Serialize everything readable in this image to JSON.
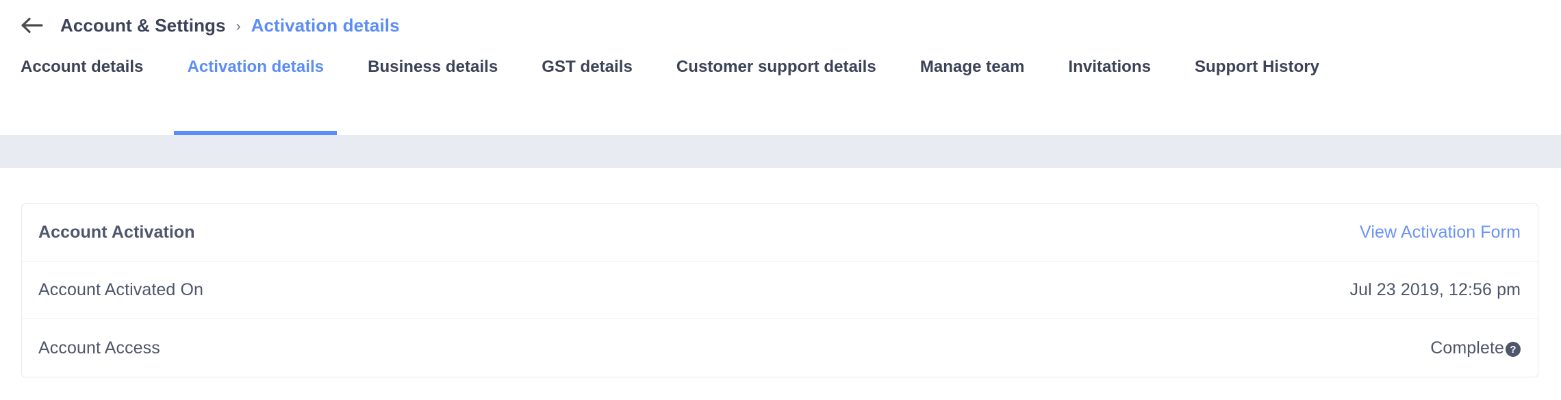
{
  "breadcrumb": {
    "back_icon": "arrow-left-icon",
    "root_label": "Account & Settings",
    "separator": "›",
    "current_label": "Activation details"
  },
  "tabs": [
    {
      "label": "Account details",
      "active": false
    },
    {
      "label": "Activation details",
      "active": true
    },
    {
      "label": "Business details",
      "active": false
    },
    {
      "label": "GST details",
      "active": false
    },
    {
      "label": "Customer support details",
      "active": false
    },
    {
      "label": "Manage team",
      "active": false
    },
    {
      "label": "Invitations",
      "active": false
    },
    {
      "label": "Support History",
      "active": false
    }
  ],
  "card": {
    "header": {
      "title": "Account Activation",
      "action_label": "View Activation Form"
    },
    "rows": [
      {
        "label": "Account Activated On",
        "value": "Jul 23 2019, 12:56 pm",
        "has_help_icon": false
      },
      {
        "label": "Account Access",
        "value": "Complete",
        "has_help_icon": true,
        "help_icon_glyph": "?"
      }
    ]
  },
  "colors": {
    "accent_blue": "#5c8df6",
    "link_blue": "#6b93f4",
    "text_primary": "#3c4257",
    "text_secondary": "#4f566b",
    "band_gray": "#e8ebf2",
    "card_border": "#e6e9ef",
    "help_icon_bg": "#4f566b"
  }
}
